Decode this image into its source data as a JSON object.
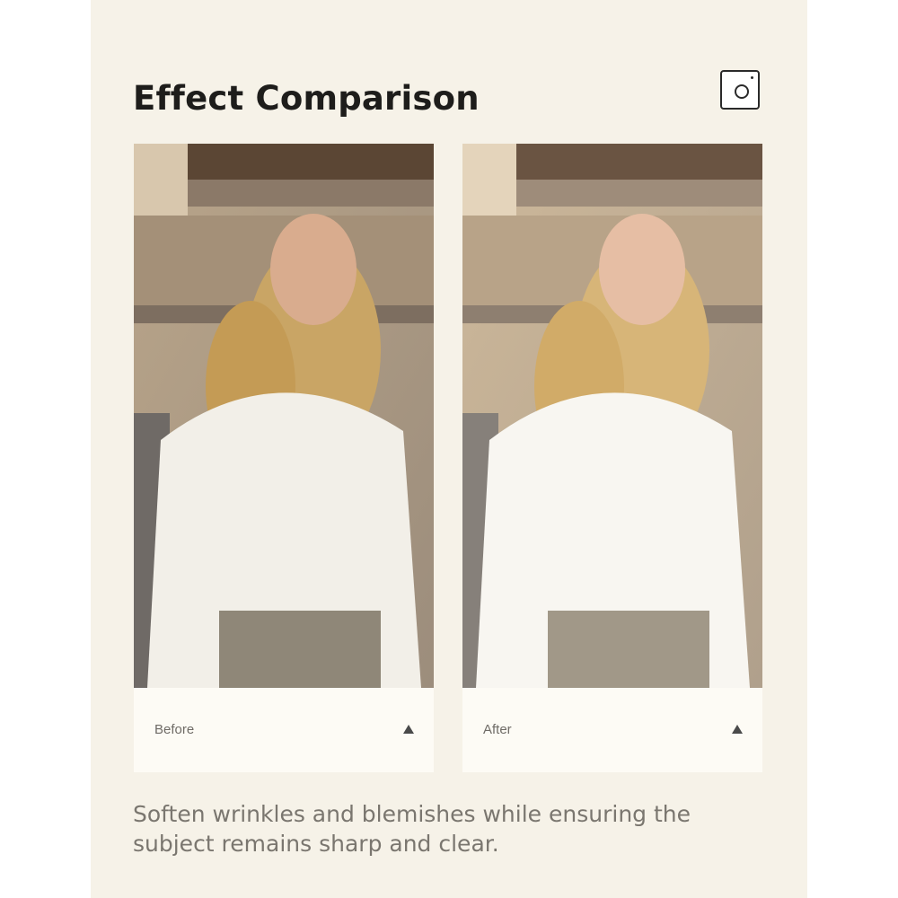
{
  "header": {
    "title": "Effect Comparison",
    "icon": "camera-icon"
  },
  "cards": [
    {
      "label": "Before",
      "icon": "triangle-up-icon",
      "image": "portrait-original"
    },
    {
      "label": "After",
      "icon": "triangle-up-icon",
      "image": "portrait-retouched"
    }
  ],
  "caption": "Soften wrinkles and blemishes while ensuring the subject remains sharp and clear.",
  "colors": {
    "background": "#f6f2e8",
    "card": "#fdfbf5",
    "title": "#1e1d1b",
    "caption": "#7a766f"
  }
}
